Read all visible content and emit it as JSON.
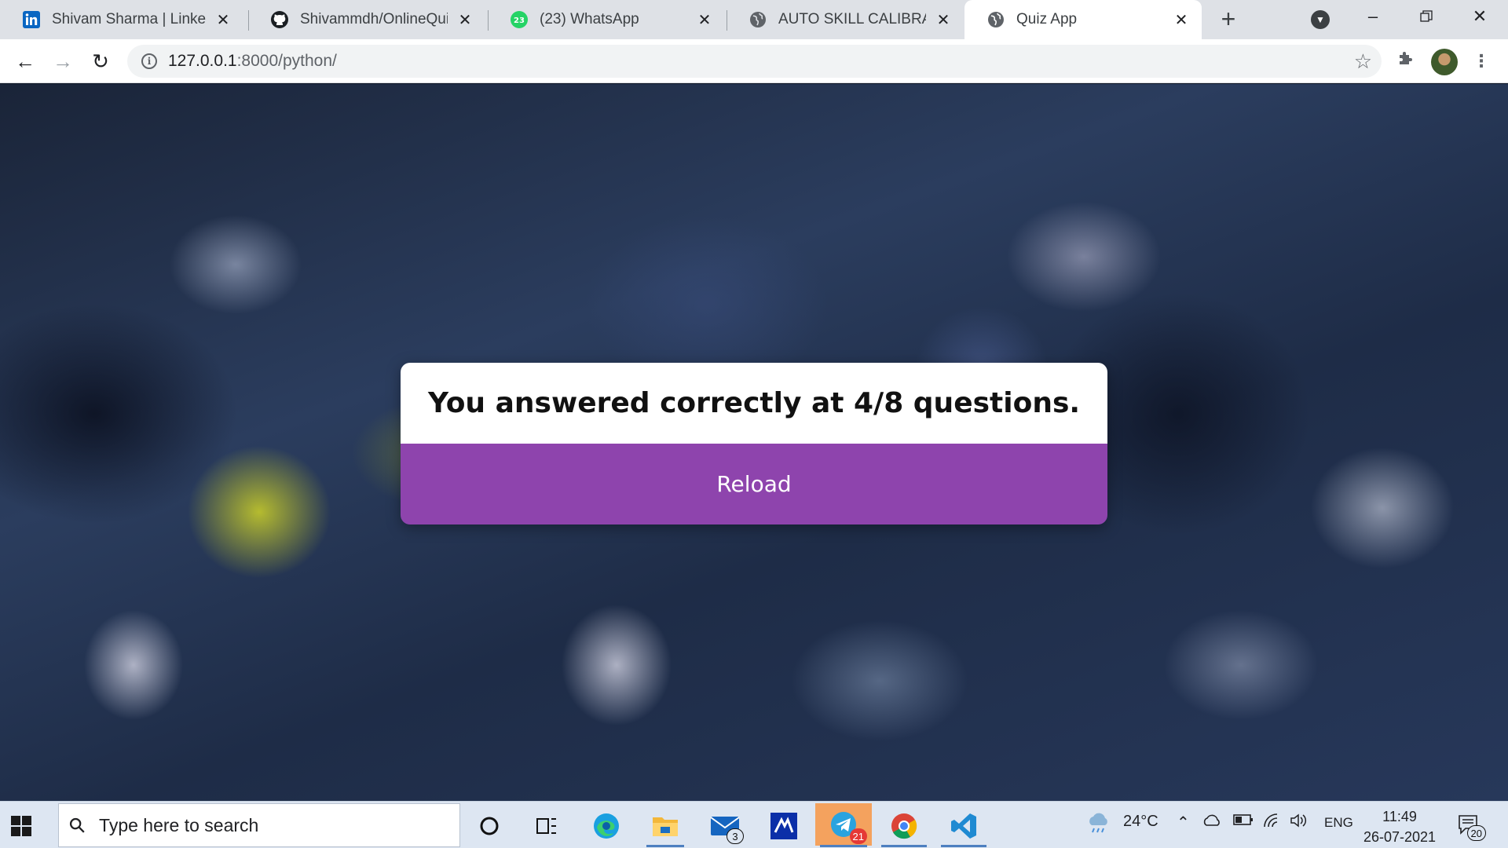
{
  "browser": {
    "tabs": [
      {
        "title": "Shivam Sharma | LinkedIn",
        "icon": "linkedin-icon",
        "active": false
      },
      {
        "title": "Shivammdh/OnlineQuizeS",
        "icon": "github-icon",
        "active": false
      },
      {
        "title": "(23) WhatsApp",
        "icon": "whatsapp-icon",
        "badge": "23",
        "active": false
      },
      {
        "title": "AUTO SKILL CALIBRATOR",
        "icon": "globe-icon",
        "active": false
      },
      {
        "title": "Quiz App",
        "icon": "globe-icon",
        "active": true
      }
    ],
    "address": {
      "host": "127.0.0.1",
      "rest": ":8000/python/"
    }
  },
  "page": {
    "result_text": "You answered correctly at 4/8 questions.",
    "reload_label": "Reload",
    "reload_color": "#8e44ad"
  },
  "taskbar": {
    "search_placeholder": "Type here to search",
    "mail_badge": "3",
    "telegram_badge": "21",
    "weather": "24°C",
    "language": "ENG",
    "time": "11:49",
    "date": "26-07-2021",
    "notifications": "20"
  }
}
